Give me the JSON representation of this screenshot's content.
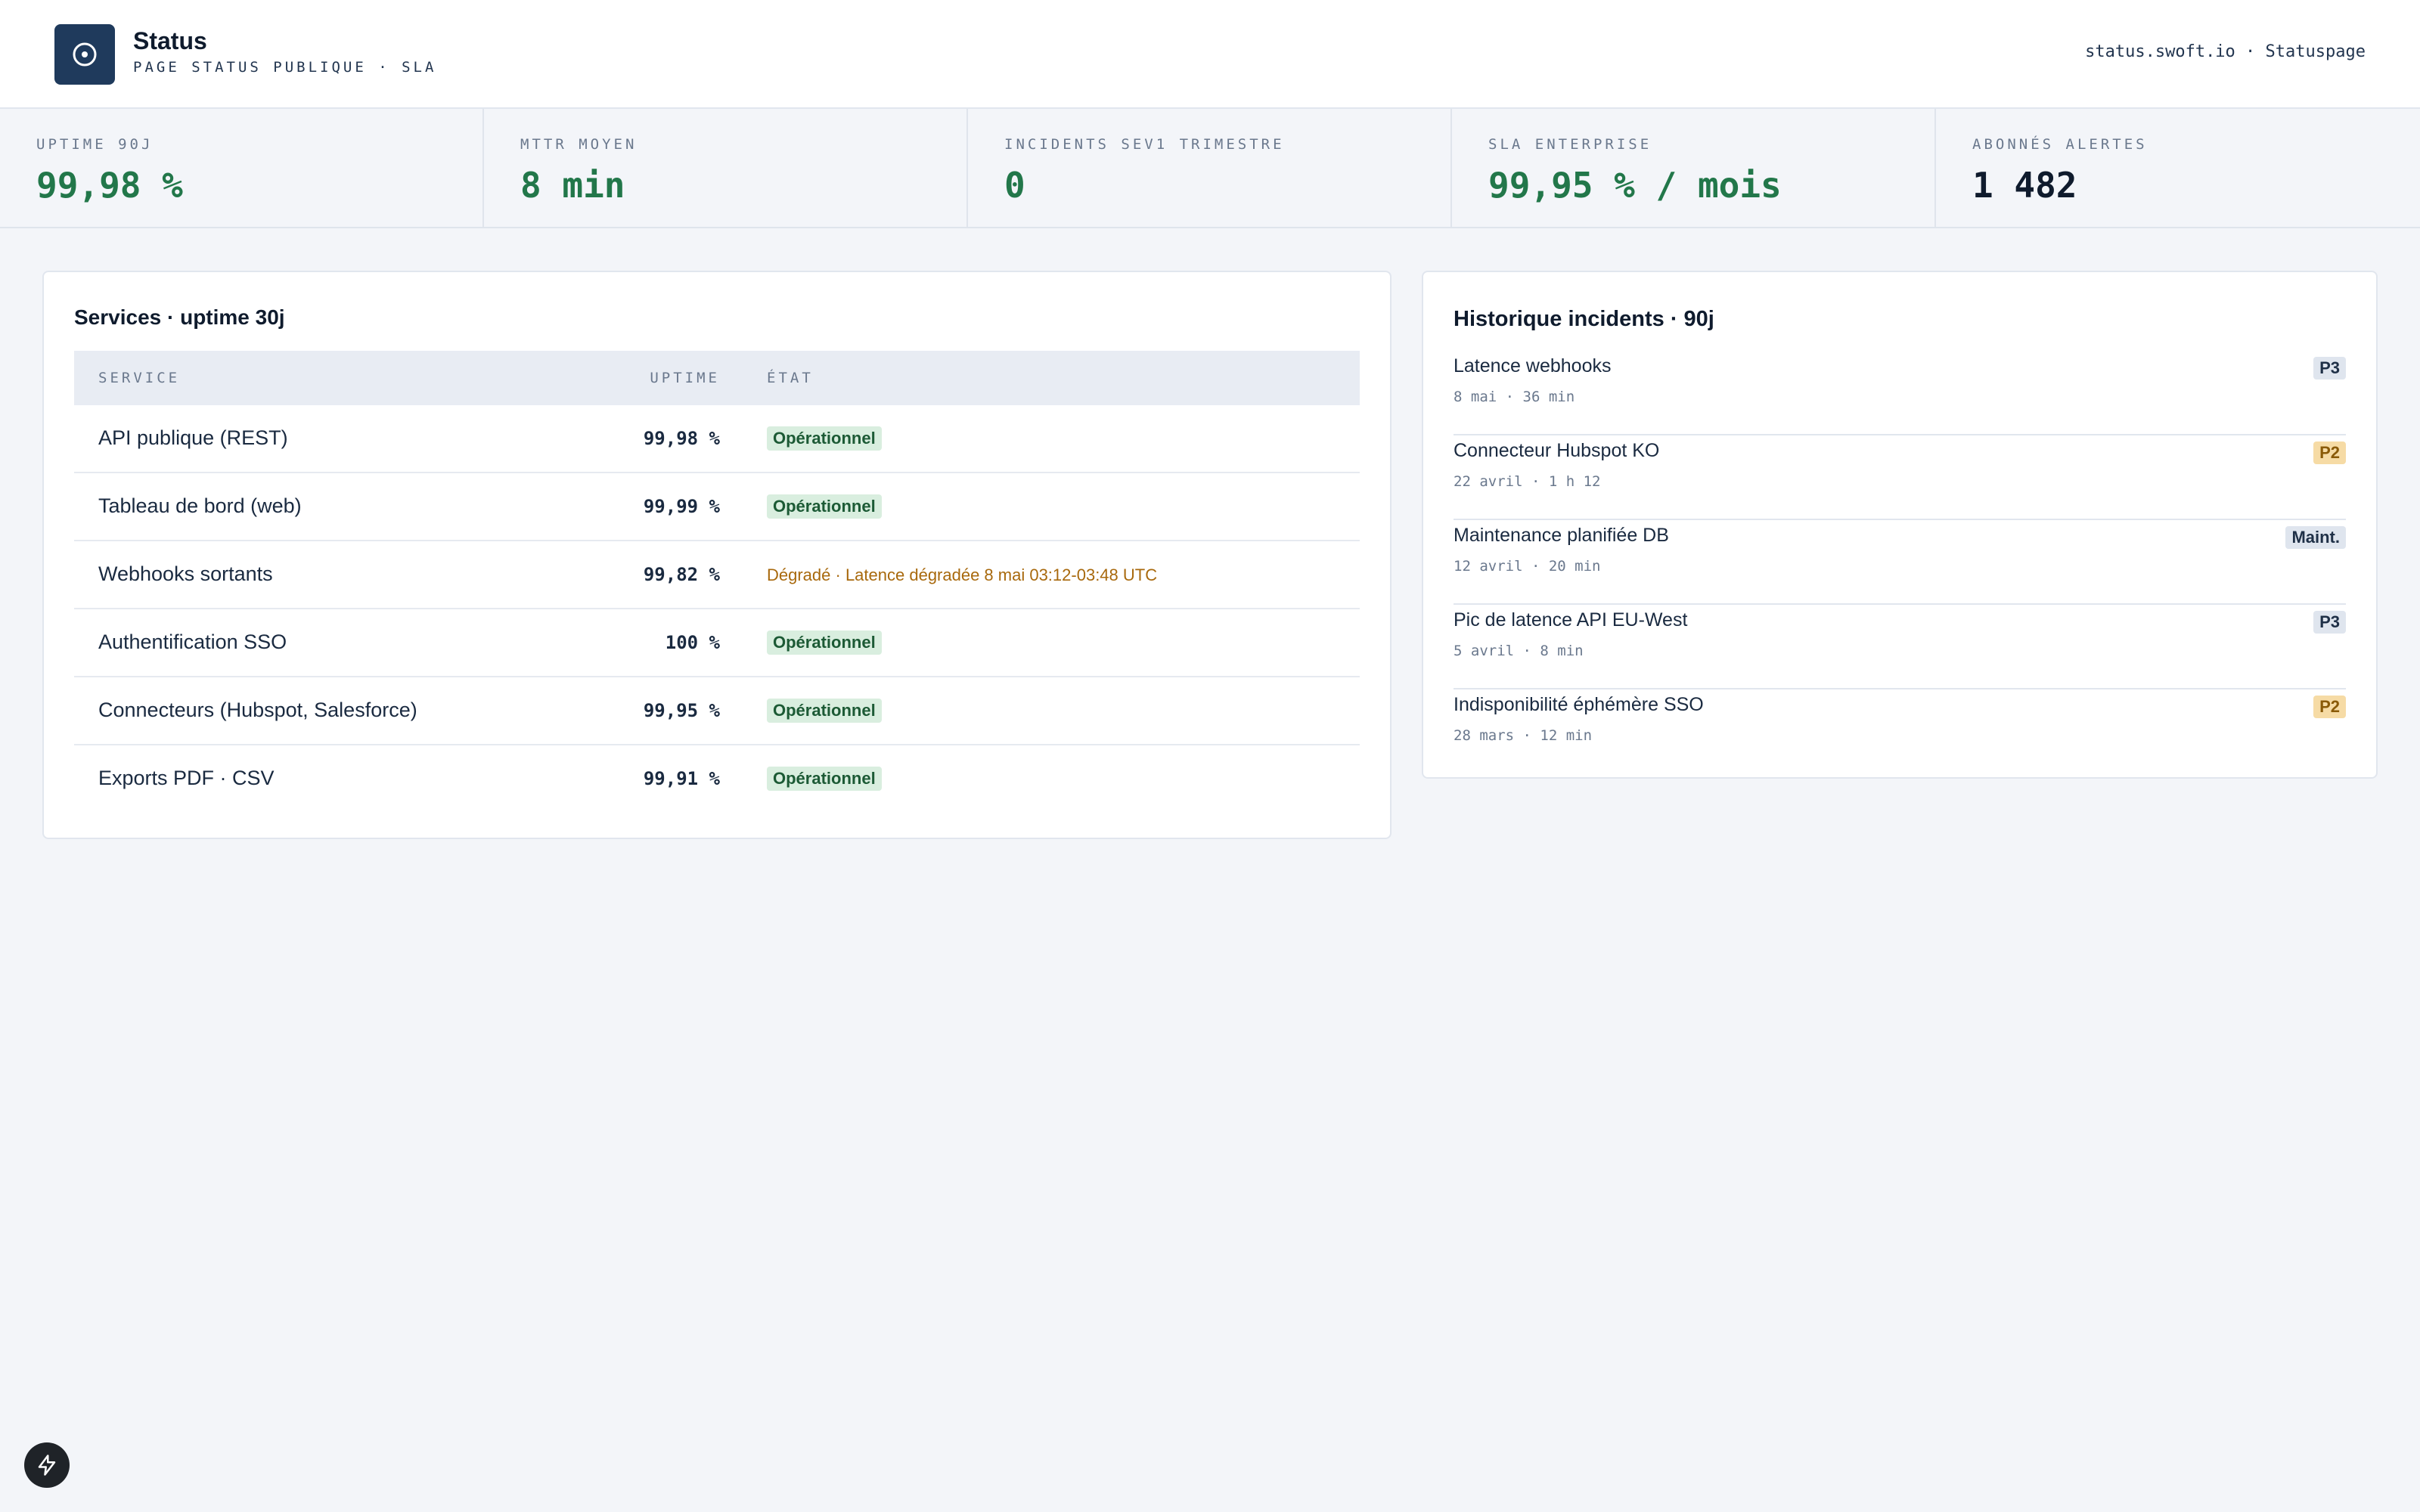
{
  "header": {
    "title": "Status",
    "subtitle": "PAGE STATUS PUBLIQUE · SLA",
    "right": "status.swoft.io · Statuspage",
    "logo_icon": "target-icon"
  },
  "kpis": [
    {
      "label": "UPTIME 90J",
      "value": "99,98 %"
    },
    {
      "label": "MTTR MOYEN",
      "value": "8 min"
    },
    {
      "label": "INCIDENTS SEV1 TRIMESTRE",
      "value": "0"
    },
    {
      "label": "SLA ENTERPRISE",
      "value": "99,95 % / mois"
    },
    {
      "label": "ABONNÉS ALERTES",
      "value": "1 482"
    }
  ],
  "services": {
    "title": "Services · uptime 30j",
    "columns": {
      "service": "SERVICE",
      "uptime": "UPTIME",
      "state": "ÉTAT"
    },
    "rows": [
      {
        "name": "API publique (REST)",
        "uptime": "99,98 %",
        "state": "Opérationnel"
      },
      {
        "name": "Tableau de bord (web)",
        "uptime": "99,99 %",
        "state": "Opérationnel"
      },
      {
        "name": "Webhooks sortants",
        "uptime": "99,82 %",
        "state": "Dégradé · Latence dégradée 8 mai 03:12-03:48 UTC"
      },
      {
        "name": "Authentification SSO",
        "uptime": "100 %",
        "state": "Opérationnel"
      },
      {
        "name": "Connecteurs (Hubspot, Salesforce)",
        "uptime": "99,95 %",
        "state": "Opérationnel"
      },
      {
        "name": "Exports PDF · CSV",
        "uptime": "99,91 %",
        "state": "Opérationnel"
      }
    ]
  },
  "incidents": {
    "title": "Historique incidents · 90j",
    "items": [
      {
        "title": "Latence webhooks",
        "meta": "8 mai  ·  36 min",
        "severity": "P3"
      },
      {
        "title": "Connecteur Hubspot KO",
        "meta": "22 avril  ·  1 h 12",
        "severity": "P2"
      },
      {
        "title": "Maintenance planifiée DB",
        "meta": "12 avril  ·  20 min",
        "severity": "Maint."
      },
      {
        "title": "Pic de latence API EU-West",
        "meta": "5 avril  ·  8 min",
        "severity": "P3"
      },
      {
        "title": "Indisponibilité éphémère SSO",
        "meta": "28 mars  ·  12 min",
        "severity": "P2"
      }
    ]
  },
  "colors": {
    "ok": "#22774a",
    "degraded": "#a8690d",
    "brand": "#1f3a5c"
  }
}
